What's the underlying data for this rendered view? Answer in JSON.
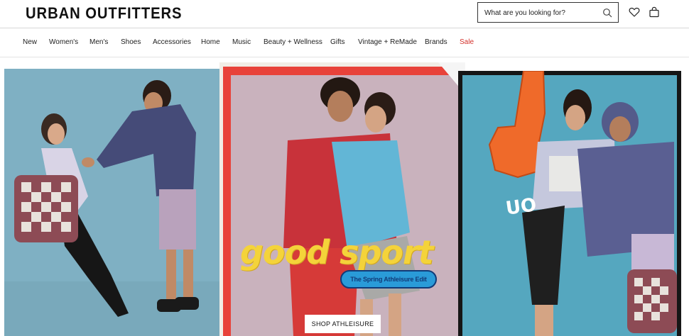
{
  "header": {
    "logo": "URBAN OUTFITTERS",
    "search": {
      "placeholder": "What are you looking for?"
    },
    "icons": [
      "search-icon",
      "heart-icon",
      "shopping-bag-icon"
    ]
  },
  "nav": {
    "items": [
      {
        "label": "New"
      },
      {
        "label": "Women's"
      },
      {
        "label": "Men's"
      },
      {
        "label": "Shoes"
      },
      {
        "label": "Accessories"
      },
      {
        "label": "Home"
      },
      {
        "label": "Music"
      },
      {
        "label": "Beauty + Wellness"
      },
      {
        "label": "Gifts"
      },
      {
        "label": "Vintage + ReMade"
      },
      {
        "label": "Brands"
      },
      {
        "label": "Sale"
      }
    ],
    "sale_color": "#d3302a"
  },
  "hero": {
    "headline": "good sport",
    "tagline": "The Spring Athleisure Edit",
    "foam_finger": "UO",
    "cta": "SHOP ATHLEISURE",
    "colors": {
      "backdrop": "#7fb0c3",
      "headline": "#f4d33a",
      "frame": "#e8423a",
      "badge": "#2a9bd8",
      "foam": "#ef6a2a"
    }
  }
}
